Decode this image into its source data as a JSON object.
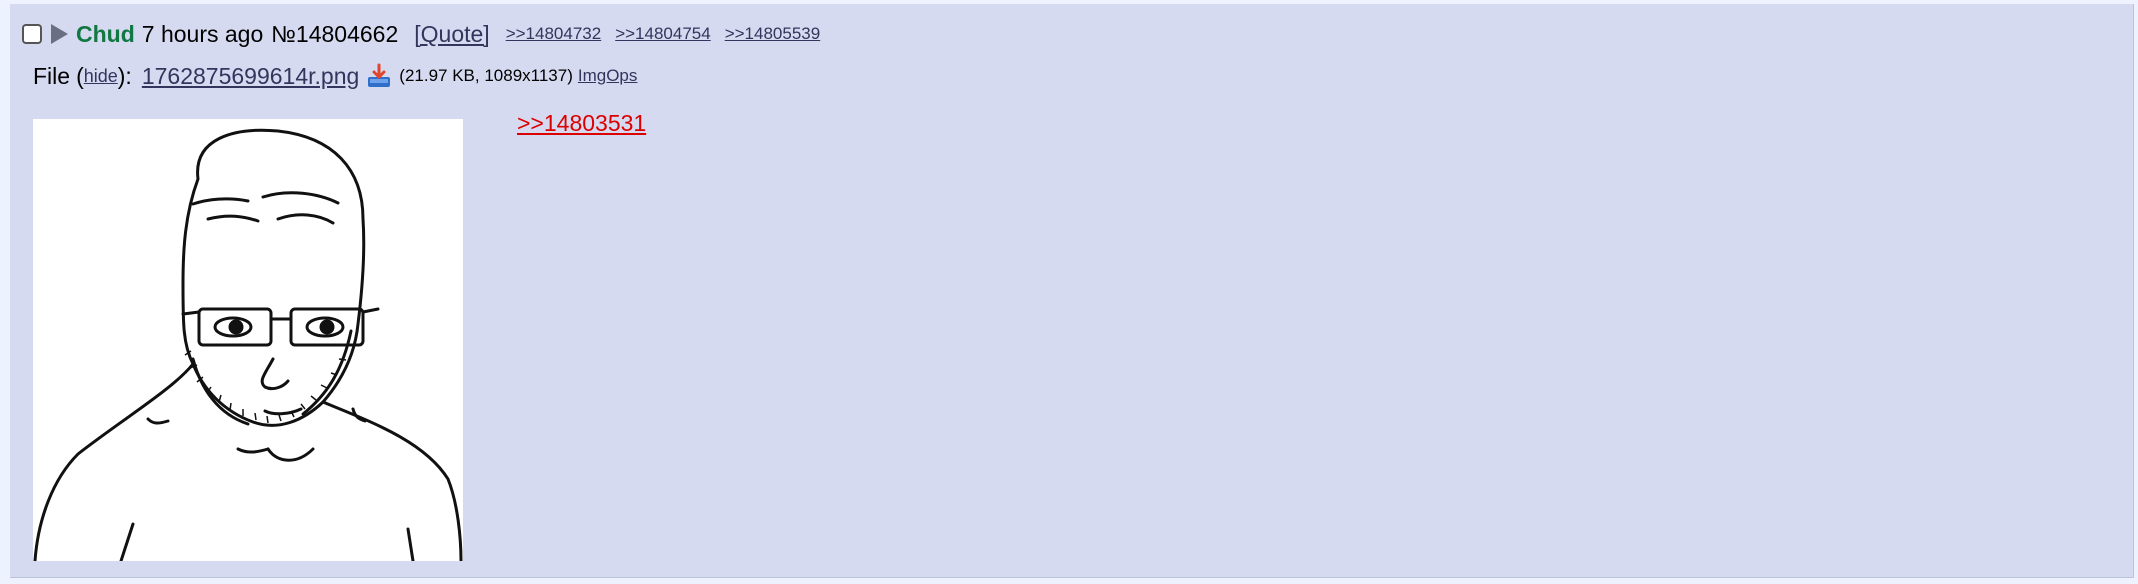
{
  "post": {
    "name": "Chud",
    "date": "7 hours ago",
    "number": "№14804662",
    "quote_label": "[Quote]",
    "backlinks": [
      ">>14804732",
      ">>14804754",
      ">>14805539"
    ]
  },
  "file": {
    "label": "File",
    "open_paren": "(",
    "hide_label": "hide",
    "close_paren": "):",
    "filename": "1762875699614r.png",
    "info": "(21.97 KB, 1089x1137)",
    "imgops_label": "ImgOps"
  },
  "message": {
    "quotelink": ">>14803531",
    "body": ""
  },
  "colors": {
    "post_bg": "#d6daf0",
    "page_bg": "#eef2ff",
    "name": "#117743",
    "link": "#34345c",
    "quotelink": "#dd0000"
  },
  "icons": {
    "menu": "triangle-right-icon",
    "download": "download-icon"
  }
}
